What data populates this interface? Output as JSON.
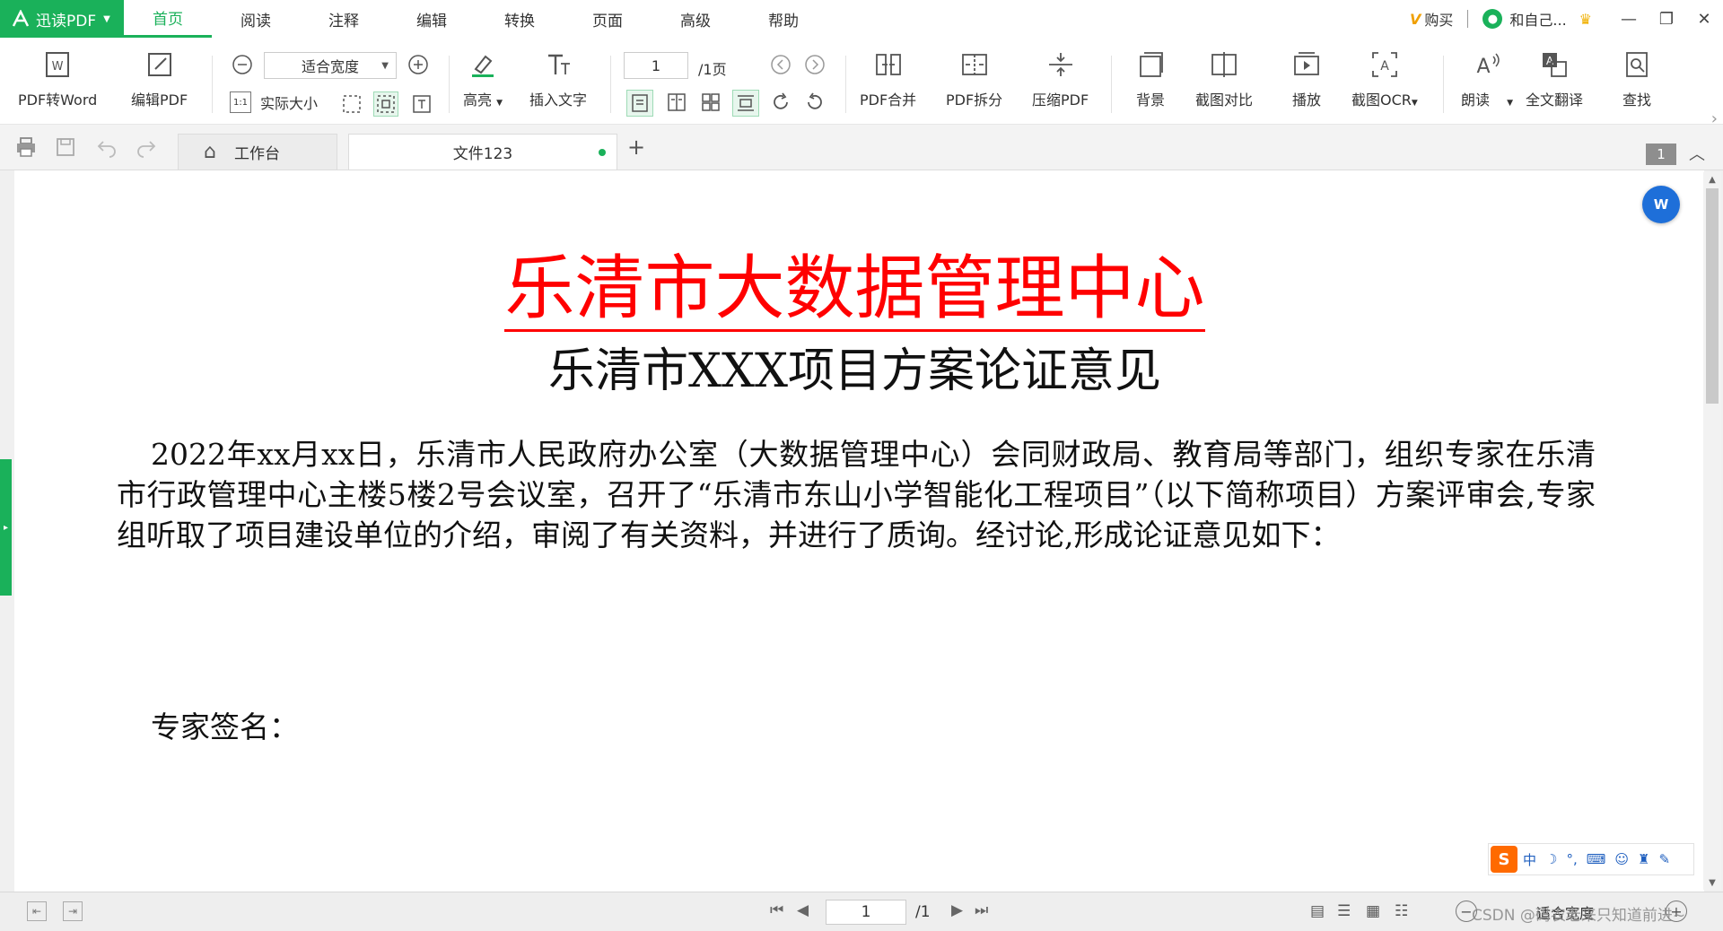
{
  "app": {
    "brand": "迅读PDF",
    "menu_tabs": [
      "首页",
      "阅读",
      "注释",
      "编辑",
      "转换",
      "页面",
      "高级",
      "帮助"
    ],
    "active_tab": "首页",
    "vip_label": "购买",
    "user_name": "和自己...",
    "accent_color": "#1ab15a"
  },
  "toolbar": {
    "pdf_to_word": "PDF转Word",
    "edit_pdf": "编辑PDF",
    "zoom_value": "适合宽度",
    "actual_size": "实际大小",
    "highlight": "高亮",
    "insert_text": "插入文字",
    "page_current": "1",
    "page_total": "/1页",
    "pdf_merge": "PDF合并",
    "pdf_split": "PDF拆分",
    "compress_pdf": "压缩PDF",
    "background": "背景",
    "compare": "截图对比",
    "play": "播放",
    "ocr": "截图OCR",
    "read_aloud": "朗读",
    "translate": "全文翻译",
    "find": "查找"
  },
  "tabs": {
    "home_tab": "工作台",
    "file_tab": "文件123",
    "page_count_badge": "1"
  },
  "document": {
    "heading_red": "乐清市大数据管理中心",
    "heading_red_color": "#ff0000",
    "subheading": "乐清市XXX项目方案论证意见",
    "paragraph": "2022年xx月xx日，乐清市人民政府办公室（大数据管理中心）会同财政局、教育局等部门，组织专家在乐清市行政管理中心主楼5楼2号会议室，召开了“乐清市东山小学智能化工程项目”（以下简称项目）方案评审会,专家组听取了项目建设单位的介绍，审阅了有关资料，并进行了质询。经讨论,形成论证意见如下：",
    "signature_label": "专家签名："
  },
  "ime": {
    "logo": "S",
    "mode": "中"
  },
  "statusbar": {
    "page_current": "1",
    "page_total": "/1",
    "zoom": "适合宽度",
    "watermark": "CSDN @码农老来只知道前进~"
  }
}
